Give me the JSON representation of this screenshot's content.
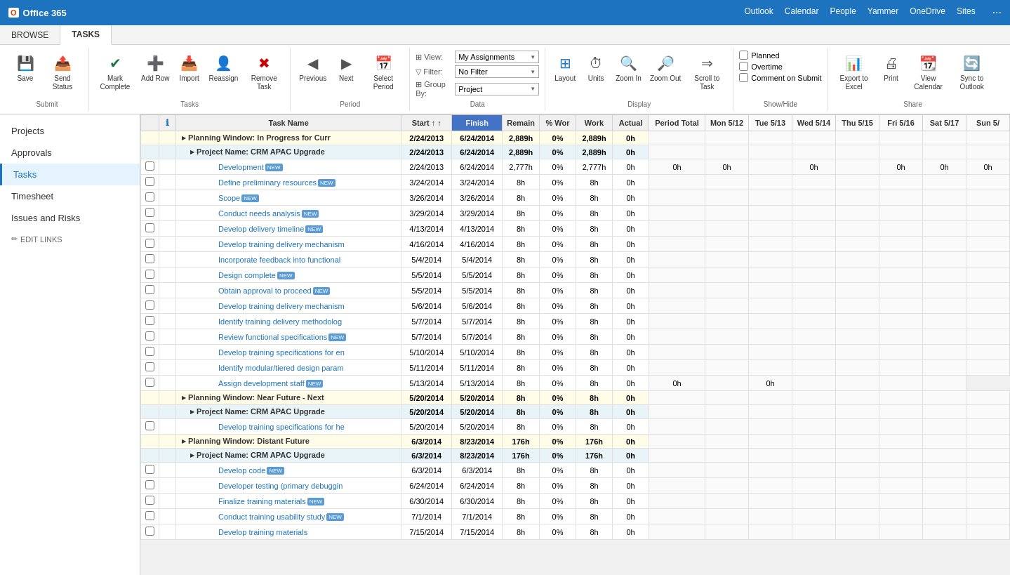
{
  "topbar": {
    "logo": "Office 365",
    "nav_items": [
      "Outlook",
      "Calendar",
      "People",
      "Yammer",
      "OneDrive",
      "Sites"
    ]
  },
  "tabs": [
    {
      "id": "browse",
      "label": "BROWSE"
    },
    {
      "id": "tasks",
      "label": "TASKS",
      "active": true
    }
  ],
  "ribbon": {
    "groups": [
      {
        "label": "Submit",
        "buttons": [
          {
            "id": "save",
            "label": "Save",
            "icon": "💾"
          },
          {
            "id": "send-status",
            "label": "Send Status",
            "icon": "📤",
            "has_arrow": true
          }
        ]
      },
      {
        "label": "Tasks",
        "buttons": [
          {
            "id": "mark-complete",
            "label": "Mark Complete",
            "icon": "✔"
          },
          {
            "id": "add-row",
            "label": "Add Row",
            "icon": "➕",
            "has_arrow": true
          },
          {
            "id": "import",
            "label": "Import",
            "icon": "📥"
          },
          {
            "id": "reassign",
            "label": "Reassign",
            "icon": "👤"
          },
          {
            "id": "remove-task",
            "label": "Remove Task",
            "icon": "🗑"
          }
        ]
      },
      {
        "label": "Period",
        "buttons": [
          {
            "id": "previous",
            "label": "Previous",
            "icon": "◀"
          },
          {
            "id": "next",
            "label": "Next",
            "icon": "▶"
          },
          {
            "id": "select-period",
            "label": "Select Period",
            "icon": "📅"
          }
        ]
      },
      {
        "label": "Data",
        "dropdowns": [
          {
            "label": "View:",
            "value": "My Assignments"
          },
          {
            "label": "Filter:",
            "value": "No Filter"
          },
          {
            "label": "Group By:",
            "value": "Project"
          }
        ]
      },
      {
        "label": "Display",
        "buttons": [
          {
            "id": "layout",
            "label": "Layout",
            "icon": "⊞"
          },
          {
            "id": "units",
            "label": "Units",
            "icon": "⏱",
            "has_arrow": true
          },
          {
            "id": "zoom-in",
            "label": "Zoom In",
            "icon": "🔍"
          },
          {
            "id": "zoom-out",
            "label": "Zoom Out",
            "icon": "🔎"
          },
          {
            "id": "scroll-to-task",
            "label": "Scroll to Task",
            "icon": "⇒"
          }
        ]
      },
      {
        "label": "Show/Hide",
        "checkboxes": [
          {
            "id": "planned",
            "label": "Planned",
            "checked": false
          },
          {
            "id": "overtime",
            "label": "Overtime",
            "checked": false
          },
          {
            "id": "comment-on-submit",
            "label": "Comment on Submit",
            "checked": false
          }
        ]
      },
      {
        "label": "Share",
        "buttons": [
          {
            "id": "export-to-excel",
            "label": "Export to Excel",
            "icon": "📊"
          },
          {
            "id": "print",
            "label": "Print",
            "icon": "🖨"
          },
          {
            "id": "view-calendar",
            "label": "View Calendar",
            "icon": "📆"
          },
          {
            "id": "sync-to-outlook",
            "label": "Sync to Outlook",
            "icon": "🔄"
          }
        ]
      }
    ]
  },
  "sidebar": {
    "items": [
      {
        "id": "projects",
        "label": "Projects"
      },
      {
        "id": "approvals",
        "label": "Approvals"
      },
      {
        "id": "tasks",
        "label": "Tasks",
        "active": true
      },
      {
        "id": "timesheet",
        "label": "Timesheet"
      },
      {
        "id": "issues-risks",
        "label": "Issues and Risks"
      }
    ],
    "edit_links_label": "EDIT LINKS"
  },
  "grid": {
    "headers": [
      {
        "id": "checkbox",
        "label": ""
      },
      {
        "id": "info",
        "label": ""
      },
      {
        "id": "task-name",
        "label": "Task Name"
      },
      {
        "id": "start",
        "label": "Start ↑"
      },
      {
        "id": "finish",
        "label": "Finish"
      },
      {
        "id": "remaining",
        "label": "Remain"
      },
      {
        "id": "pct-work",
        "label": "% Wor"
      },
      {
        "id": "work",
        "label": "Work"
      },
      {
        "id": "actual",
        "label": "Actual"
      },
      {
        "id": "period-total",
        "label": "Period Total"
      },
      {
        "id": "mon-512",
        "label": "Mon 5/12"
      },
      {
        "id": "tue-513",
        "label": "Tue 5/13"
      },
      {
        "id": "wed-514",
        "label": "Wed 5/14"
      },
      {
        "id": "thu-515",
        "label": "Thu 5/15"
      },
      {
        "id": "fri-516",
        "label": "Fri 5/16"
      },
      {
        "id": "sat-517",
        "label": "Sat 5/17"
      },
      {
        "id": "sun-5",
        "label": "Sun 5/"
      }
    ],
    "rows": [
      {
        "type": "planning-window",
        "cells": [
          "",
          "",
          "▸ Planning Window: In Progress for Curr",
          "2/24/2013",
          "6/24/2014",
          "2,889h",
          "0%",
          "2,889h",
          "0h",
          "",
          "",
          "",
          "",
          "",
          "",
          "",
          ""
        ]
      },
      {
        "type": "project-name",
        "cells": [
          "",
          "",
          "▸ Project Name: CRM APAC Upgrade",
          "2/24/2013",
          "6/24/2014",
          "2,889h",
          "0%",
          "2,889h",
          "0h",
          "",
          "",
          "",
          "",
          "",
          "",
          "",
          ""
        ]
      },
      {
        "type": "task",
        "cells": [
          "☐",
          "",
          "Development NEW",
          "2/24/2013",
          "6/24/2014",
          "2,777h",
          "0%",
          "2,777h",
          "0h",
          "0h",
          "0h",
          "",
          "0h",
          "",
          "0h",
          "0h",
          "0h"
        ]
      },
      {
        "type": "task",
        "cells": [
          "☐",
          "",
          "Define preliminary resources NEW",
          "3/24/2014",
          "3/24/2014",
          "8h",
          "0%",
          "8h",
          "0h",
          "",
          "",
          "",
          "",
          "",
          "",
          "",
          ""
        ]
      },
      {
        "type": "task",
        "cells": [
          "☐",
          "",
          "Scope NEW",
          "3/26/2014",
          "3/26/2014",
          "8h",
          "0%",
          "8h",
          "0h",
          "",
          "",
          "",
          "",
          "",
          "",
          "",
          ""
        ]
      },
      {
        "type": "task",
        "cells": [
          "☐",
          "",
          "Conduct needs analysis NEW",
          "3/29/2014",
          "3/29/2014",
          "8h",
          "0%",
          "8h",
          "0h",
          "",
          "",
          "",
          "",
          "",
          "",
          "",
          ""
        ]
      },
      {
        "type": "task",
        "cells": [
          "☐",
          "",
          "Develop delivery timeline NEW",
          "4/13/2014",
          "4/13/2014",
          "8h",
          "0%",
          "8h",
          "0h",
          "",
          "",
          "",
          "",
          "",
          "",
          "",
          ""
        ]
      },
      {
        "type": "task",
        "cells": [
          "☐",
          "",
          "Develop training delivery mechanism",
          "4/16/2014",
          "4/16/2014",
          "8h",
          "0%",
          "8h",
          "0h",
          "",
          "",
          "",
          "",
          "",
          "",
          "",
          ""
        ]
      },
      {
        "type": "task",
        "cells": [
          "☐",
          "",
          "Incorporate feedback into functional",
          "5/4/2014",
          "5/4/2014",
          "8h",
          "0%",
          "8h",
          "0h",
          "",
          "",
          "",
          "",
          "",
          "",
          "",
          ""
        ]
      },
      {
        "type": "task",
        "cells": [
          "☐",
          "",
          "Design complete NEW",
          "5/5/2014",
          "5/5/2014",
          "8h",
          "0%",
          "8h",
          "0h",
          "",
          "",
          "",
          "",
          "",
          "",
          "",
          ""
        ]
      },
      {
        "type": "task",
        "cells": [
          "☐",
          "",
          "Obtain approval to proceed NEW",
          "5/5/2014",
          "5/5/2014",
          "8h",
          "0%",
          "8h",
          "0h",
          "",
          "",
          "",
          "",
          "",
          "",
          "",
          ""
        ]
      },
      {
        "type": "task",
        "cells": [
          "☐",
          "",
          "Develop training delivery mechanism",
          "5/6/2014",
          "5/6/2014",
          "8h",
          "0%",
          "8h",
          "0h",
          "",
          "",
          "",
          "",
          "",
          "",
          "",
          ""
        ]
      },
      {
        "type": "task",
        "cells": [
          "☐",
          "",
          "Identify training delivery methodolog",
          "5/7/2014",
          "5/7/2014",
          "8h",
          "0%",
          "8h",
          "0h",
          "",
          "",
          "",
          "",
          "",
          "",
          "",
          ""
        ]
      },
      {
        "type": "task",
        "cells": [
          "☐",
          "",
          "Review functional specifications NEW",
          "5/7/2014",
          "5/7/2014",
          "8h",
          "0%",
          "8h",
          "0h",
          "",
          "",
          "",
          "",
          "",
          "",
          "",
          ""
        ]
      },
      {
        "type": "task",
        "cells": [
          "☐",
          "",
          "Develop training specifications for en",
          "5/10/2014",
          "5/10/2014",
          "8h",
          "0%",
          "8h",
          "0h",
          "",
          "",
          "",
          "",
          "",
          "",
          "",
          ""
        ]
      },
      {
        "type": "task",
        "cells": [
          "☐",
          "",
          "Identify modular/tiered design param",
          "5/11/2014",
          "5/11/2014",
          "8h",
          "0%",
          "8h",
          "0h",
          "",
          "",
          "",
          "",
          "",
          "",
          "",
          ""
        ]
      },
      {
        "type": "task",
        "cells": [
          "☐",
          "",
          "Assign development staff NEW",
          "5/13/2014",
          "5/13/2014",
          "8h",
          "0%",
          "8h",
          "0h",
          "0h",
          "",
          "0h",
          "",
          "",
          "",
          ""
        ]
      },
      {
        "type": "planning-window-near",
        "cells": [
          "",
          "",
          "▸ Planning Window: Near Future - Next",
          "5/20/2014",
          "5/20/2014",
          "8h",
          "0%",
          "8h",
          "0h",
          "",
          "",
          "",
          "",
          "",
          "",
          "",
          ""
        ]
      },
      {
        "type": "project-name",
        "cells": [
          "",
          "",
          "▸ Project Name: CRM APAC Upgrade",
          "5/20/2014",
          "5/20/2014",
          "8h",
          "0%",
          "8h",
          "0h",
          "",
          "",
          "",
          "",
          "",
          "",
          "",
          ""
        ]
      },
      {
        "type": "task",
        "cells": [
          "☐",
          "",
          "Develop training specifications for he",
          "5/20/2014",
          "5/20/2014",
          "8h",
          "0%",
          "8h",
          "0h",
          "",
          "",
          "",
          "",
          "",
          "",
          "",
          ""
        ]
      },
      {
        "type": "planning-window-distant",
        "cells": [
          "",
          "",
          "▸ Planning Window: Distant Future",
          "6/3/2014",
          "8/23/2014",
          "176h",
          "0%",
          "176h",
          "0h",
          "",
          "",
          "",
          "",
          "",
          "",
          "",
          ""
        ]
      },
      {
        "type": "project-name",
        "cells": [
          "",
          "",
          "▸ Project Name: CRM APAC Upgrade",
          "6/3/2014",
          "8/23/2014",
          "176h",
          "0%",
          "176h",
          "0h",
          "",
          "",
          "",
          "",
          "",
          "",
          "",
          ""
        ]
      },
      {
        "type": "task",
        "cells": [
          "☐",
          "",
          "Develop code NEW",
          "6/3/2014",
          "6/3/2014",
          "8h",
          "0%",
          "8h",
          "0h",
          "",
          "",
          "",
          "",
          "",
          "",
          "",
          ""
        ]
      },
      {
        "type": "task",
        "cells": [
          "☐",
          "",
          "Developer testing (primary debuggin",
          "6/24/2014",
          "6/24/2014",
          "8h",
          "0%",
          "8h",
          "0h",
          "",
          "",
          "",
          "",
          "",
          "",
          "",
          ""
        ]
      },
      {
        "type": "task",
        "cells": [
          "☐",
          "",
          "Finalize training materials NEW",
          "6/30/2014",
          "6/30/2014",
          "8h",
          "0%",
          "8h",
          "0h",
          "",
          "",
          "",
          "",
          "",
          "",
          "",
          ""
        ]
      },
      {
        "type": "task",
        "cells": [
          "☐",
          "",
          "Conduct training usability study NEW",
          "7/1/2014",
          "7/1/2014",
          "8h",
          "0%",
          "8h",
          "0h",
          "",
          "",
          "",
          "",
          "",
          "",
          "",
          ""
        ]
      },
      {
        "type": "task",
        "cells": [
          "☐",
          "",
          "Develop training materials",
          "7/15/2014",
          "7/15/2014",
          "8h",
          "0%",
          "8h",
          "0h",
          "",
          "",
          "",
          "",
          "",
          "",
          "",
          ""
        ]
      }
    ]
  }
}
